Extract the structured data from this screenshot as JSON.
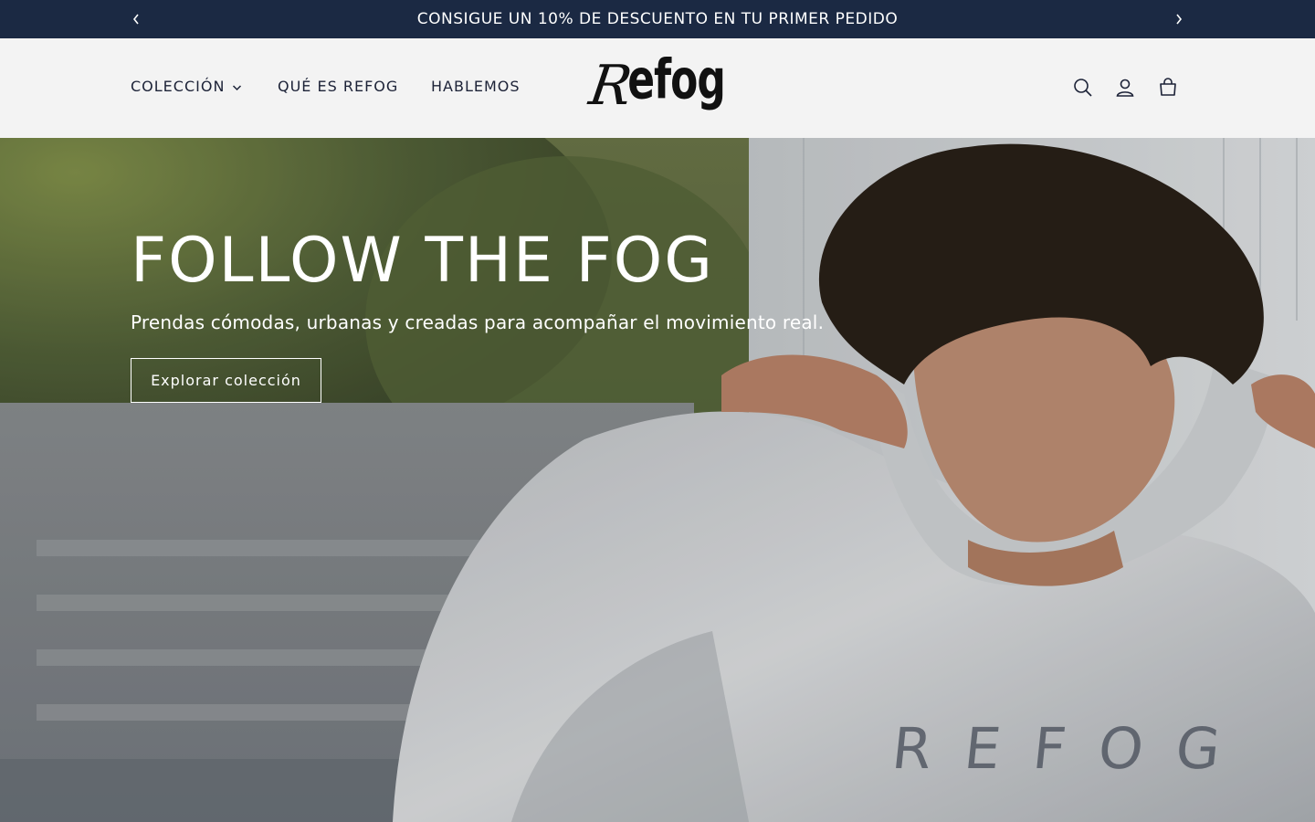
{
  "announcement": {
    "message": "CONSIGUE UN 10% DE DESCUENTO EN TU PRIMER PEDIDO",
    "prev_icon": "chevron-left-icon",
    "next_icon": "chevron-right-icon"
  },
  "header": {
    "nav": [
      {
        "label": "COLECCIÓN",
        "has_dropdown": true
      },
      {
        "label": "QUÉ ES REFOG"
      },
      {
        "label": "HABLEMOS"
      }
    ],
    "logo": {
      "initial": "R",
      "rest": "efog"
    },
    "icons": [
      "search-icon",
      "account-icon",
      "cart-icon"
    ]
  },
  "hero": {
    "title": "FOLLOW THE FOG",
    "subtitle": "Prendas cómodas, urbanas y creadas para acompañar el movimiento real.",
    "button_label": "Explorar colección",
    "hoodie_print": "REFOG"
  },
  "colors": {
    "announcement_bg": "#1b2943",
    "header_bg": "#f3f3f3",
    "text_dark": "#1c2237",
    "hero_text": "#ffffff"
  }
}
